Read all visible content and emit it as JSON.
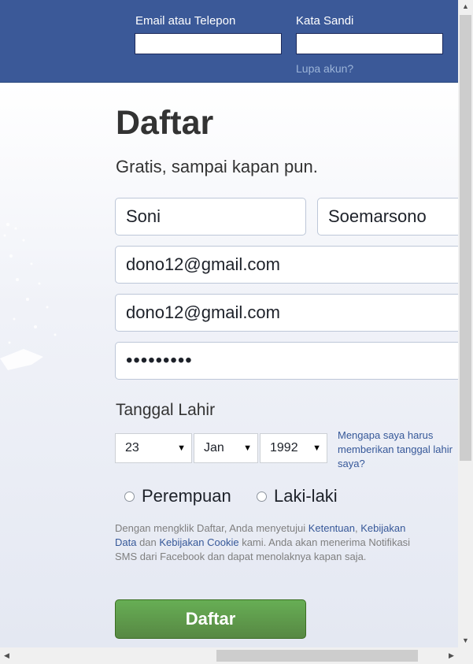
{
  "header": {
    "email_label": "Email atau Telepon",
    "password_label": "Kata Sandi",
    "forgot_link": "Lupa akun?"
  },
  "signup": {
    "title": "Daftar",
    "subtitle": "Gratis, sampai kapan pun.",
    "first_name": "Soni",
    "last_name": "Soemarsono",
    "email": "dono12@gmail.com",
    "email_confirm": "dono12@gmail.com",
    "password": "•••••••••",
    "birthday_label": "Tanggal Lahir",
    "birthday_day": "23",
    "birthday_month": "Jan",
    "birthday_year": "1992",
    "birthday_why": "Mengapa saya harus memberikan tanggal lahir saya?",
    "gender_female": "Perempuan",
    "gender_male": "Laki-laki",
    "terms": {
      "part1": "Dengan mengklik Daftar, Anda menyetujui ",
      "link_terms": "Ketentuan",
      "sep1": ", ",
      "link_data": "Kebijakan Data",
      "part2": " dan ",
      "link_cookie": "Kebijakan Cookie",
      "part3": " kami. Anda akan menerima Notifikasi SMS dari Facebook dan dapat menolaknya kapan saja."
    },
    "submit_label": "Daftar"
  },
  "icons": {
    "dropdown": "triangle-down",
    "scroll_up": "triangle-up",
    "scroll_down": "triangle-down",
    "scroll_left": "triangle-left",
    "scroll_right": "triangle-right"
  },
  "colors": {
    "brand": "#3b5998",
    "button": "#5b9f47",
    "link": "#365899"
  }
}
